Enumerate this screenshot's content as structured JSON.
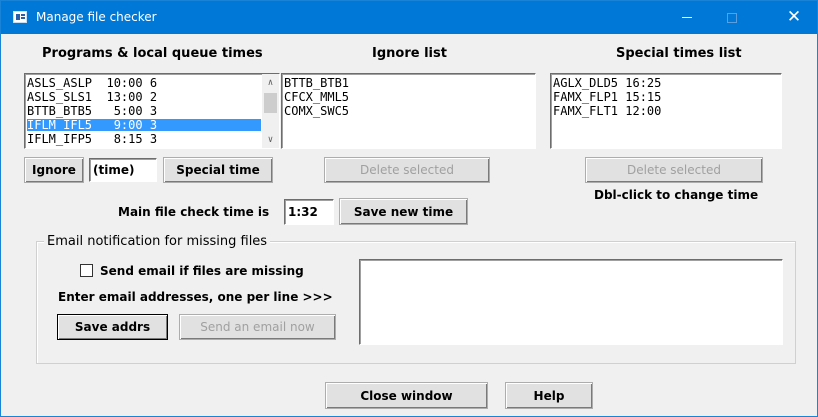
{
  "window": {
    "title": "Manage file checker",
    "minimize_label": "—",
    "maximize_label": "",
    "close_label": "✕"
  },
  "programs": {
    "heading": "Programs & local queue times",
    "rows": [
      {
        "text": "ASLS_ASLP  10:00 6",
        "selected": false
      },
      {
        "text": "ASLS_SLS1  13:00 2",
        "selected": false
      },
      {
        "text": "BTTB_BTB5   5:00 3",
        "selected": false
      },
      {
        "text": "IFLM_IFL5   9:00 3",
        "selected": true
      },
      {
        "text": "IFLM_IFP5   8:15 3",
        "selected": false
      }
    ],
    "scroll_up": "∧",
    "scroll_down": "∨"
  },
  "ignore_list": {
    "heading": "Ignore list",
    "rows": [
      "BTTB_BTB1",
      "CFCX_MML5",
      "COMX_SWC5"
    ]
  },
  "special_times": {
    "heading": "Special times list",
    "rows": [
      "AGLX_DLD5 16:25",
      "FAMX_FLP1 15:15",
      "FAMX_FLT1 12:00"
    ]
  },
  "buttons": {
    "ignore": "Ignore",
    "time_value": "(time)",
    "special_time": "Special time",
    "delete_selected_ignore": "Delete selected",
    "delete_selected_special": "Delete selected",
    "save_new_time": "Save new time",
    "save_addrs": "Save addrs",
    "send_email_now": "Send an email now",
    "close_window": "Close window",
    "help": "Help"
  },
  "hints": {
    "dbl_click": "Dbl-click to change time"
  },
  "main_check": {
    "label": "Main file check time is",
    "value": "1:32"
  },
  "email": {
    "group_title": "Email notification for missing files",
    "checkbox_label": "Send email if files are missing",
    "checkbox_checked": false,
    "instructions": "Enter email addresses, one per line >>>",
    "addresses": ""
  },
  "colors": {
    "titlebar": "#0078d7",
    "selection": "#3399ff",
    "window_bg": "#f0f0f0"
  }
}
